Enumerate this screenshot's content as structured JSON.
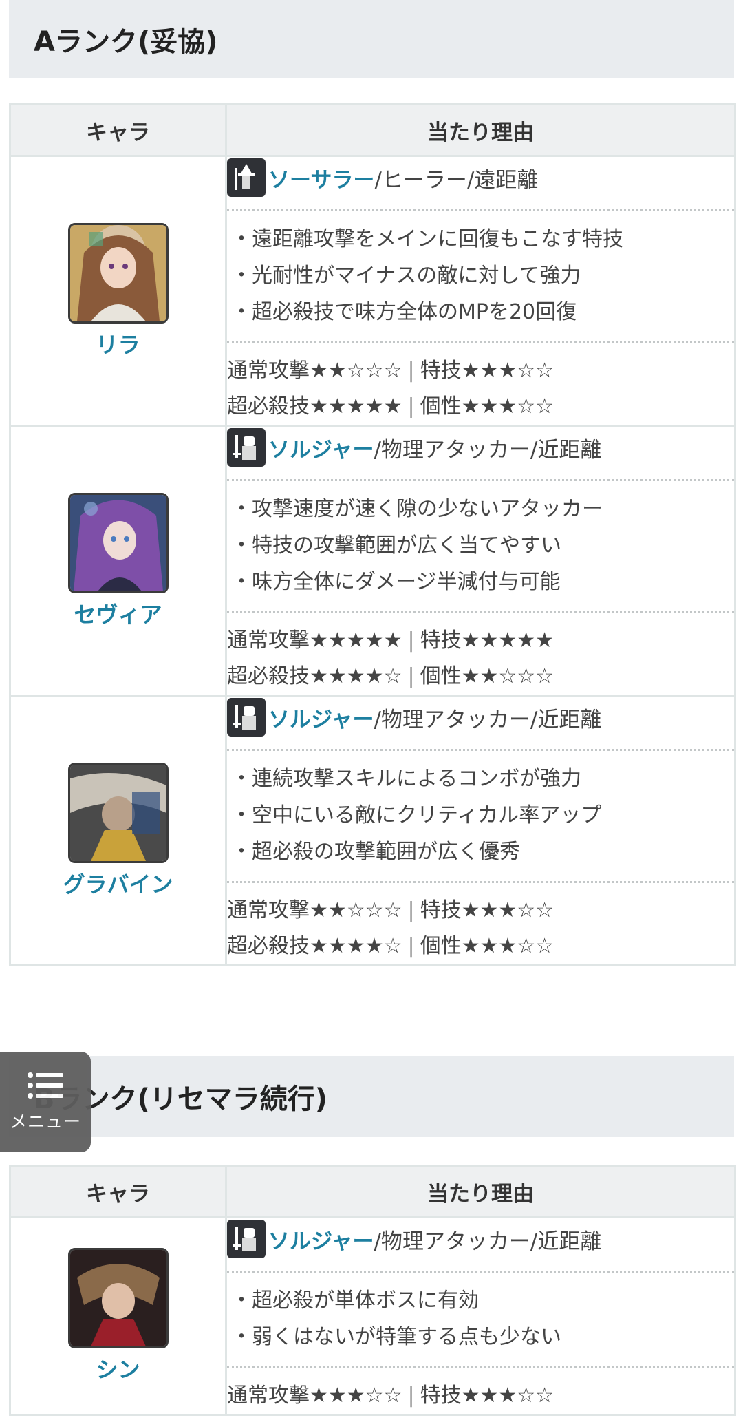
{
  "section_a": {
    "title": "Aランク(妥協)",
    "headers": {
      "character": "キャラ",
      "reason": "当たり理由"
    },
    "rows": [
      {
        "name": "リラ",
        "class_name": "ソーサラー",
        "class_rest": "/ヒーラー/遠距離",
        "class_icon": "sorcerer-icon",
        "points": [
          "・遠距離攻撃をメインに回復もこなす特技",
          "・光耐性がマイナスの敵に対して強力",
          "・超必殺技で味方全体のMPを20回復"
        ],
        "rating_line1": [
          "通常攻撃★★☆☆☆",
          "特技★★★☆☆"
        ],
        "rating_line2": [
          "超必殺技★★★★★",
          "個性★★★☆☆"
        ]
      },
      {
        "name": "セヴィア",
        "class_name": "ソルジャー",
        "class_rest": "/物理アタッカー/近距離",
        "class_icon": "soldier-icon",
        "points": [
          "・攻撃速度が速く隙の少ないアタッカー",
          "・特技の攻撃範囲が広く当てやすい",
          "・味方全体にダメージ半減付与可能"
        ],
        "rating_line1": [
          "通常攻撃★★★★★",
          "特技★★★★★"
        ],
        "rating_line2": [
          "超必殺技★★★★☆",
          "個性★★☆☆☆"
        ]
      },
      {
        "name": "グラバイン",
        "class_name": "ソルジャー",
        "class_rest": "/物理アタッカー/近距離",
        "class_icon": "soldier-icon",
        "points": [
          "・連続攻撃スキルによるコンボが強力",
          "・空中にいる敵にクリティカル率アップ",
          "・超必殺の攻撃範囲が広く優秀"
        ],
        "rating_line1": [
          "通常攻撃★★☆☆☆",
          "特技★★★☆☆"
        ],
        "rating_line2": [
          "超必殺技★★★★☆",
          "個性★★★☆☆"
        ]
      }
    ]
  },
  "section_b": {
    "title": "Bランク(リセマラ続行)",
    "headers": {
      "character": "キャラ",
      "reason": "当たり理由"
    },
    "rows": [
      {
        "name": "シン",
        "class_name": "ソルジャー",
        "class_rest": "/物理アタッカー/近距離",
        "class_icon": "soldier-icon",
        "points": [
          "・超必殺が単体ボスに有効",
          "・弱くはないが特筆する点も少ない"
        ],
        "rating_line1": [
          "通常攻撃★★★☆☆",
          "特技★★★☆☆"
        ]
      }
    ]
  },
  "menu": {
    "label": "メニュー",
    "icon": "list-icon"
  },
  "colors": {
    "accent": "#1d7fa0",
    "header_bg": "#e9ecef",
    "border": "#dfe5e5"
  }
}
